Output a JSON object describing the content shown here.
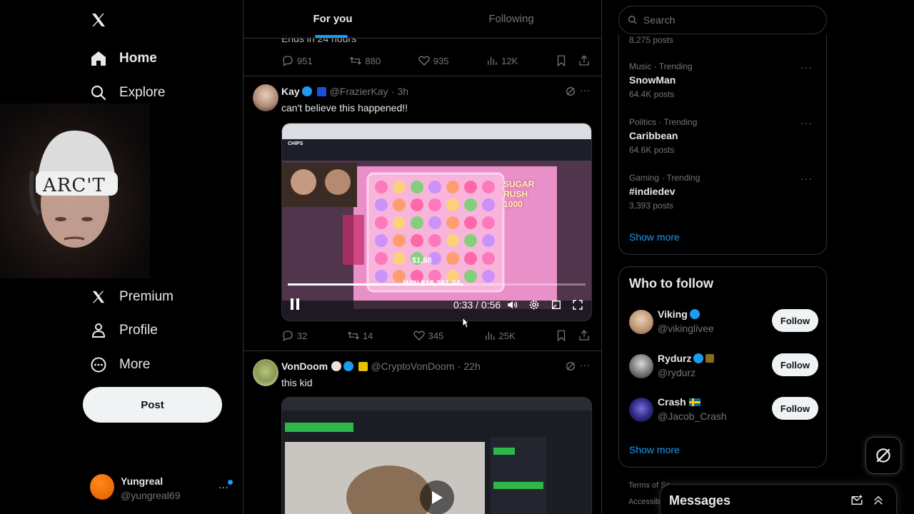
{
  "nav": {
    "home": "Home",
    "explore": "Explore",
    "premium": "Premium",
    "profile": "Profile",
    "more": "More",
    "post": "Post",
    "account": {
      "name": "Yungreal",
      "handle": "@yungreal69"
    }
  },
  "webcam": {
    "headband_text": "ARC'T"
  },
  "tabs": {
    "for_you": "For you",
    "following": "Following"
  },
  "tweet0": {
    "text": "Ends in 24 hours",
    "replies": "951",
    "reposts": "880",
    "likes": "935",
    "views": "12K"
  },
  "tweet1": {
    "name": "Kay",
    "handle": "@FrazierKay",
    "time": "· 3h",
    "text": "can't believe this happened!!",
    "video": {
      "time": "0:33 / 0:56",
      "progress": 0.59,
      "site_logo": "CHIPS",
      "win_text": "WIN $18,261.34",
      "game_title": "SUGAR RUSH 1000",
      "mult_text": "$1,68"
    },
    "replies": "32",
    "reposts": "14",
    "likes": "345",
    "views": "25K"
  },
  "tweet2": {
    "name": "VonDoom",
    "handle": "@CryptoVonDoom",
    "time": "· 22h",
    "text": "this kid"
  },
  "search": {
    "placeholder": "Search"
  },
  "trends": {
    "top_count": "8,275 posts",
    "items": [
      {
        "category": "Music · Trending",
        "title": "SnowMan",
        "count": "64.4K posts"
      },
      {
        "category": "Politics · Trending",
        "title": "Caribbean",
        "count": "64.6K posts"
      },
      {
        "category": "Gaming · Trending",
        "title": "#indiedev",
        "count": "3,393 posts"
      }
    ],
    "show_more": "Show more"
  },
  "who_to_follow": {
    "title": "Who to follow",
    "users": [
      {
        "name": "Viking",
        "handle": "@vikinglivee",
        "button": "Follow"
      },
      {
        "name": "Rydurz",
        "handle": "@rydurz",
        "button": "Follow"
      },
      {
        "name": "Crash",
        "handle": "@Jacob_Crash",
        "button": "Follow"
      }
    ],
    "show_more": "Show more"
  },
  "footer": {
    "terms": "Terms of Se",
    "access": "Accessibili"
  },
  "messages": {
    "title": "Messages"
  }
}
